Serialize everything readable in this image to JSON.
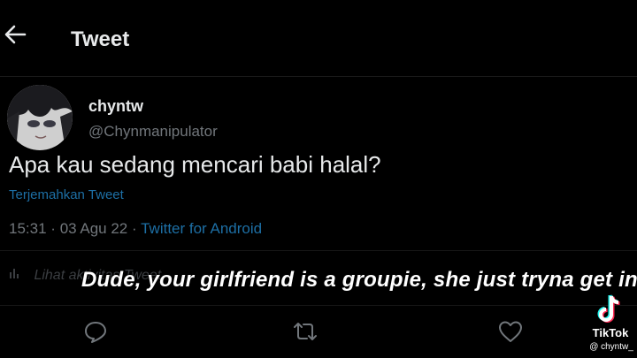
{
  "header": {
    "title": "Tweet",
    "back_icon": "arrow-left-icon"
  },
  "tweet": {
    "display_name": "chyntw",
    "handle": "@Chynmanipulator",
    "text": "Apa kau sedang mencari babi halal?",
    "translate_label": "Terjemahkan Tweet",
    "time": "15:31",
    "date": "03 Agu 22",
    "source": "Twitter for Android",
    "separator": "·",
    "activity_label": "Lihat aktivitas Tweet"
  },
  "caption": {
    "text": "Dude, your girlfriend is a groupie, she just tryna get in"
  },
  "actions": {
    "reply_icon": "reply-icon",
    "retweet_icon": "retweet-icon",
    "like_icon": "heart-icon"
  },
  "watermark": {
    "brand": "TikTok",
    "user": "@ chyntw_"
  },
  "colors": {
    "background": "#000000",
    "text": "#e7e9ea",
    "muted": "#71767b",
    "link": "#1d6fa5"
  }
}
